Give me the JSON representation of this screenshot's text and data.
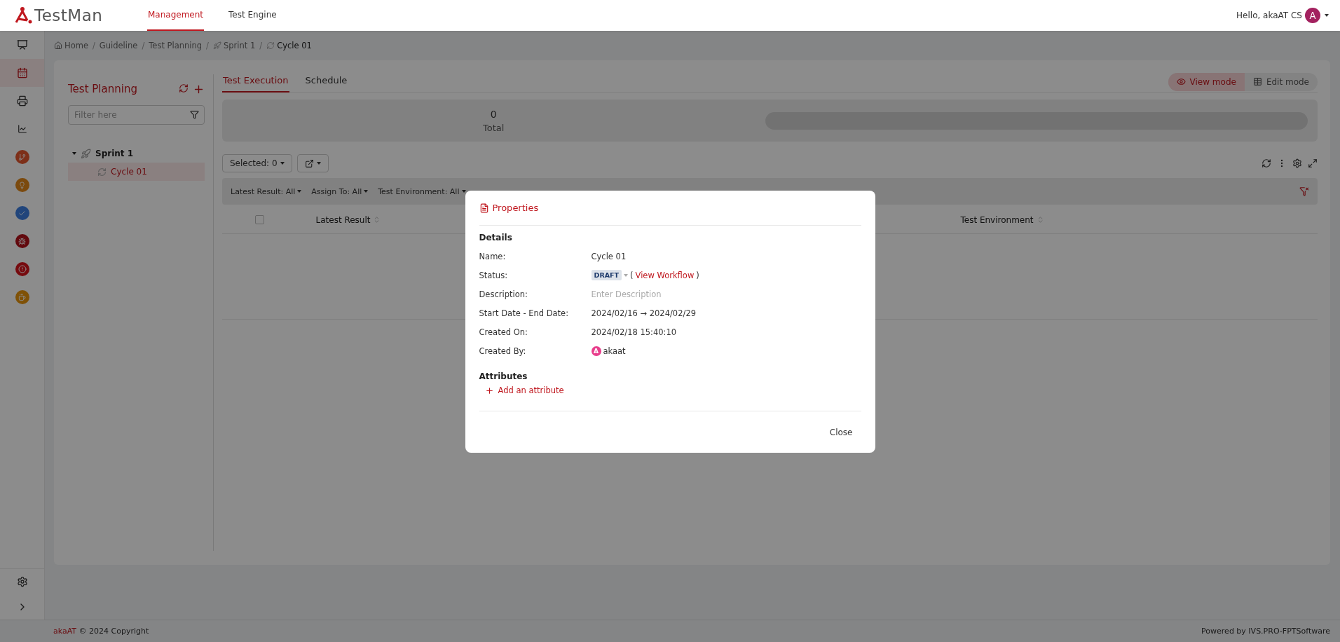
{
  "app": {
    "logo": "TestMan"
  },
  "nav_tabs": [
    {
      "label": "Management",
      "selected": true
    },
    {
      "label": "Test Engine",
      "selected": false
    }
  ],
  "user": {
    "greeting": "Hello, akaAT CS",
    "avatar": "A"
  },
  "sidebar": {
    "items": [
      {
        "kind": "presentation",
        "selected": false
      },
      {
        "kind": "calendar",
        "selected": true
      },
      {
        "kind": "printer",
        "selected": false
      },
      {
        "kind": "chart",
        "selected": false
      },
      {
        "kind": "branch",
        "selected": false
      },
      {
        "kind": "bulb",
        "selected": false
      },
      {
        "kind": "check",
        "selected": false
      },
      {
        "kind": "bug",
        "selected": false
      },
      {
        "kind": "alert",
        "selected": false
      },
      {
        "kind": "cup",
        "selected": false
      }
    ],
    "bottom": [
      {
        "kind": "settings"
      },
      {
        "kind": "expand"
      }
    ]
  },
  "breadcrumb": [
    {
      "label": "Home",
      "kind": "home"
    },
    {
      "sep": "/",
      "label": "Guideline",
      "kind": "plain"
    },
    {
      "sep": "/",
      "label": "Test Planning",
      "kind": "plain"
    },
    {
      "sep": "/",
      "label": "Sprint 1",
      "kind": "rocket"
    },
    {
      "sep": "/",
      "label": "Cycle 01",
      "kind": "cycle"
    }
  ],
  "tree_panel": {
    "title": "Test Planning",
    "filter_placeholder": "Filter here",
    "tree": [
      {
        "label": "Sprint 1",
        "expanded": true,
        "selected": false,
        "children": [
          {
            "label": "Cycle 01",
            "selected": true
          }
        ]
      }
    ]
  },
  "tabs": [
    {
      "label": "Test Execution",
      "selected": true
    },
    {
      "label": "Schedule",
      "selected": false
    }
  ],
  "modes": [
    {
      "label": "View mode",
      "kind": "view",
      "selected": true
    },
    {
      "label": "Edit mode",
      "kind": "edit",
      "selected": false
    }
  ],
  "summary": {
    "total": "0",
    "total_label": "Total",
    "progress": {
      "level": 0
    }
  },
  "toolbar": {
    "selected": "Selected: 0"
  },
  "filters": [
    {
      "label": "Latest Result: All"
    },
    {
      "label": "Assign To: All"
    },
    {
      "label": "Test Environment: All"
    }
  ],
  "table": {
    "select_all": {
      "checked": false
    },
    "columns": [
      {
        "label": "Latest Result"
      },
      {
        "label": "Test Environment"
      }
    ]
  },
  "modal": {
    "title": "Properties",
    "details_heading": "Details",
    "fields": [
      {
        "label": "Name:",
        "kind": "text",
        "value": "Cycle 01"
      },
      {
        "label": "Status:",
        "kind": "status",
        "badge": "DRAFT",
        "open_paren": "(",
        "link": "View Workflow",
        "close_paren": ")"
      },
      {
        "label": "Description:",
        "kind": "input",
        "placeholder": "Enter Description"
      },
      {
        "label": "Start Date - End Date:",
        "kind": "text",
        "value": "2024/02/16 → 2024/02/29"
      },
      {
        "label": "Created On:",
        "kind": "text",
        "value": "2024/02/18 15:40:10"
      },
      {
        "label": "Created By:",
        "kind": "user",
        "avatar": "A",
        "value": "akaat"
      }
    ],
    "attributes_heading": "Attributes",
    "add_attribute": "Add an attribute",
    "close": "Close"
  },
  "footer": {
    "brand": "akaAT",
    "copyright": "© 2024 Copyright",
    "powered_by": "Powered by",
    "company": "IVS.PRO-FPTSoftware"
  }
}
